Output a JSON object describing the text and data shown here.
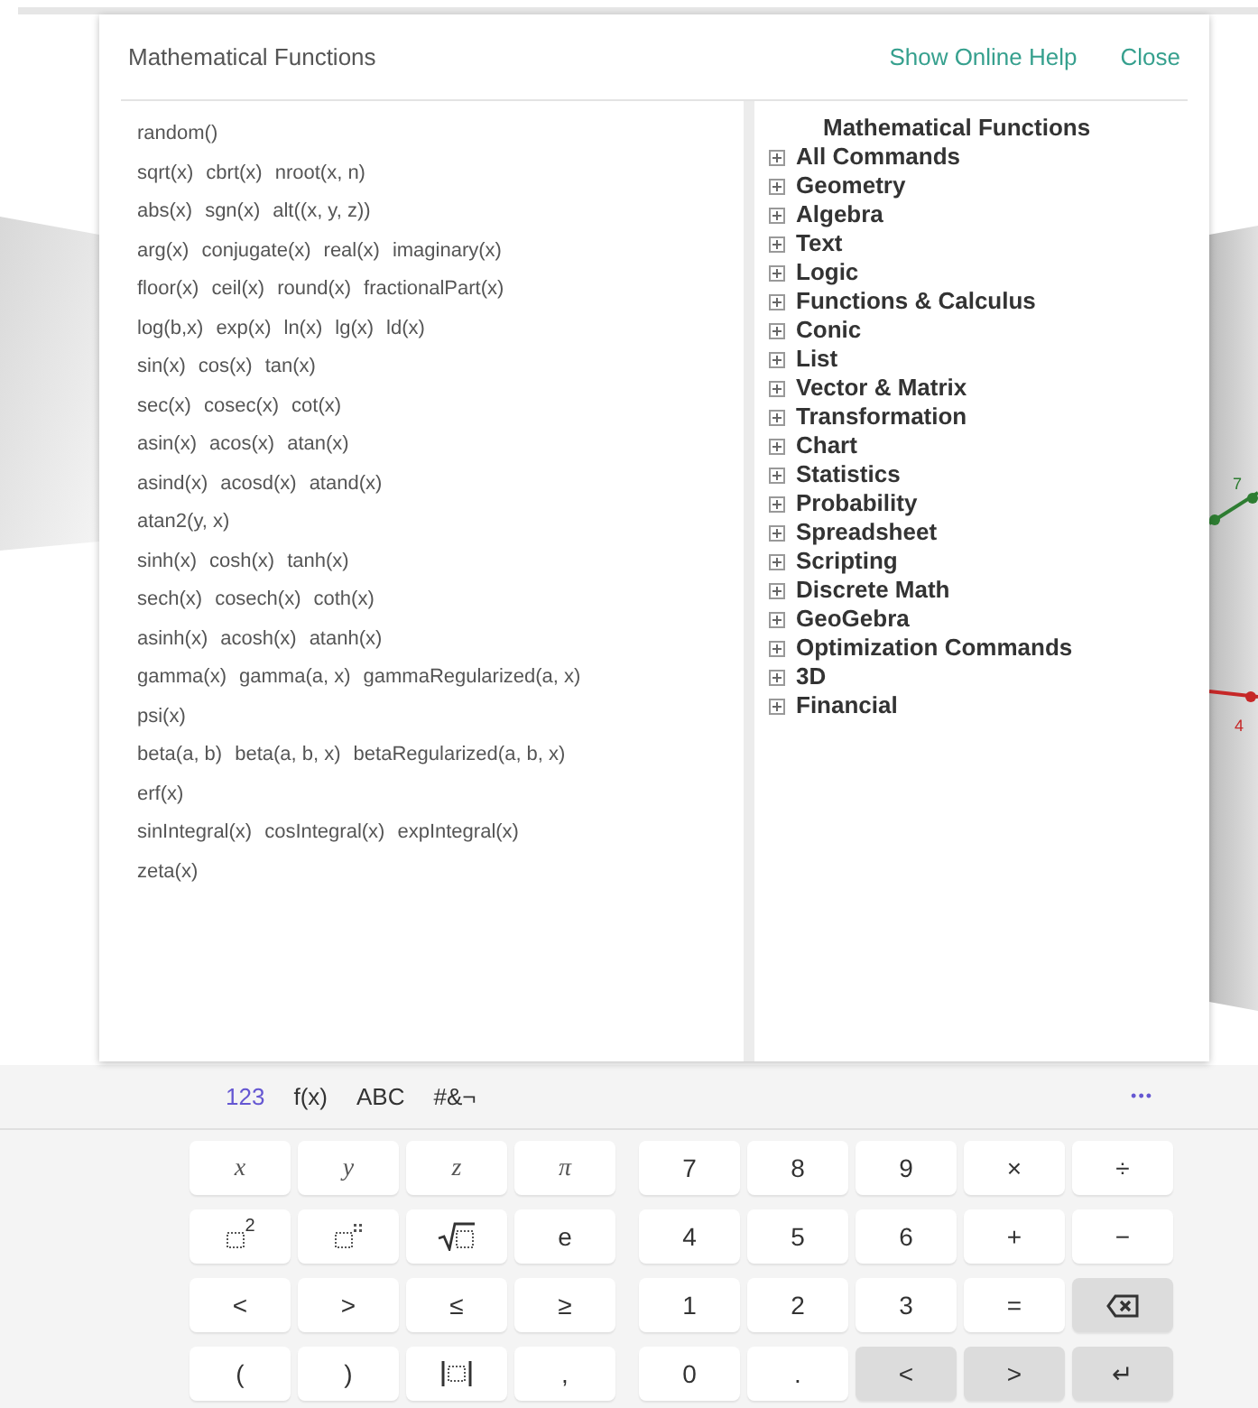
{
  "dialog": {
    "title": "Mathematical Functions",
    "links": [
      "Show Online Help",
      "Close"
    ]
  },
  "functions": [
    [
      "random()"
    ],
    [
      "sqrt(x)",
      "cbrt(x)",
      "nroot(x, n)"
    ],
    [
      "abs(x)",
      "sgn(x)",
      "alt((x, y, z))"
    ],
    [
      "arg(x)",
      "conjugate(x)",
      "real(x)",
      "imaginary(x)"
    ],
    [
      "floor(x)",
      "ceil(x)",
      "round(x)",
      "fractionalPart(x)"
    ],
    [
      "log(b,x)",
      "exp(x)",
      "ln(x)",
      "lg(x)",
      "ld(x)"
    ],
    [
      "sin(x)",
      "cos(x)",
      "tan(x)"
    ],
    [
      "sec(x)",
      "cosec(x)",
      "cot(x)"
    ],
    [
      "asin(x)",
      "acos(x)",
      "atan(x)"
    ],
    [
      "asind(x)",
      "acosd(x)",
      "atand(x)"
    ],
    [
      "atan2(y, x)"
    ],
    [
      "sinh(x)",
      "cosh(x)",
      "tanh(x)"
    ],
    [
      "sech(x)",
      "cosech(x)",
      "coth(x)"
    ],
    [
      "asinh(x)",
      "acosh(x)",
      "atanh(x)"
    ],
    [
      "gamma(x)",
      "gamma(a, x)",
      "gammaRegularized(a, x)"
    ],
    [
      "psi(x)"
    ],
    [
      "beta(a, b)",
      "beta(a, b, x)",
      "betaRegularized(a, b, x)"
    ],
    [
      "erf(x)"
    ],
    [
      "sinIntegral(x)",
      "cosIntegral(x)",
      "expIntegral(x)"
    ],
    [
      "zeta(x)"
    ]
  ],
  "command_tree": {
    "heading": "Mathematical Functions",
    "items": [
      {
        "label": "All Commands",
        "expanded": false
      },
      {
        "label": "Geometry",
        "expanded": false
      },
      {
        "label": "Algebra",
        "expanded": false
      },
      {
        "label": "Text",
        "expanded": false
      },
      {
        "label": "Logic",
        "expanded": false
      },
      {
        "label": "Functions & Calculus",
        "expanded": false
      },
      {
        "label": "Conic",
        "expanded": false
      },
      {
        "label": "List",
        "expanded": false
      },
      {
        "label": "Vector & Matrix",
        "expanded": false
      },
      {
        "label": "Transformation",
        "expanded": false
      },
      {
        "label": "Chart",
        "expanded": false
      },
      {
        "label": "Statistics",
        "expanded": false
      },
      {
        "label": "Probability",
        "expanded": false
      },
      {
        "label": "Spreadsheet",
        "expanded": false
      },
      {
        "label": "Scripting",
        "expanded": false
      },
      {
        "label": "Discrete Math",
        "expanded": false
      },
      {
        "label": "GeoGebra",
        "expanded": false
      },
      {
        "label": "Optimization Commands",
        "expanded": false
      },
      {
        "label": "3D",
        "expanded": false
      },
      {
        "label": "Financial",
        "expanded": false
      }
    ]
  },
  "graph": {
    "labels": [
      {
        "text": "7",
        "color": "#2e7d32"
      },
      {
        "text": "4",
        "color": "#c62828"
      }
    ]
  },
  "keyboard": {
    "tabs": [
      {
        "label": "123",
        "selected": true
      },
      {
        "label": "f(x)",
        "selected": false
      },
      {
        "label": "ABC",
        "selected": false
      },
      {
        "label": "#&¬",
        "selected": false
      }
    ],
    "more": "•••",
    "left_keys": [
      {
        "kind": "var",
        "label": "x"
      },
      {
        "kind": "var",
        "label": "y"
      },
      {
        "kind": "var",
        "label": "z"
      },
      {
        "kind": "var",
        "label": "π"
      },
      {
        "kind": "power",
        "label": "2"
      },
      {
        "kind": "power"
      },
      {
        "kind": "sqrt"
      },
      {
        "kind": "text",
        "label": "e"
      },
      {
        "kind": "text",
        "label": "<"
      },
      {
        "kind": "text",
        "label": ">"
      },
      {
        "kind": "text",
        "label": "≤"
      },
      {
        "kind": "text",
        "label": "≥"
      },
      {
        "kind": "text",
        "label": "("
      },
      {
        "kind": "text",
        "label": ")"
      },
      {
        "kind": "abs"
      },
      {
        "kind": "text",
        "label": ","
      }
    ],
    "right_keys": [
      {
        "kind": "text",
        "label": "7"
      },
      {
        "kind": "text",
        "label": "8"
      },
      {
        "kind": "text",
        "label": "9"
      },
      {
        "kind": "text",
        "label": "×"
      },
      {
        "kind": "text",
        "label": "÷"
      },
      {
        "kind": "text",
        "label": "4"
      },
      {
        "kind": "text",
        "label": "5"
      },
      {
        "kind": "text",
        "label": "6"
      },
      {
        "kind": "text",
        "label": "+"
      },
      {
        "kind": "text",
        "label": "−"
      },
      {
        "kind": "text",
        "label": "1"
      },
      {
        "kind": "text",
        "label": "2"
      },
      {
        "kind": "text",
        "label": "3"
      },
      {
        "kind": "text",
        "label": "="
      },
      {
        "kind": "backspace"
      },
      {
        "kind": "text",
        "label": "0"
      },
      {
        "kind": "text",
        "label": "."
      },
      {
        "kind": "action",
        "label": "<"
      },
      {
        "kind": "action",
        "label": ">"
      },
      {
        "kind": "action",
        "label": "↵"
      }
    ]
  }
}
